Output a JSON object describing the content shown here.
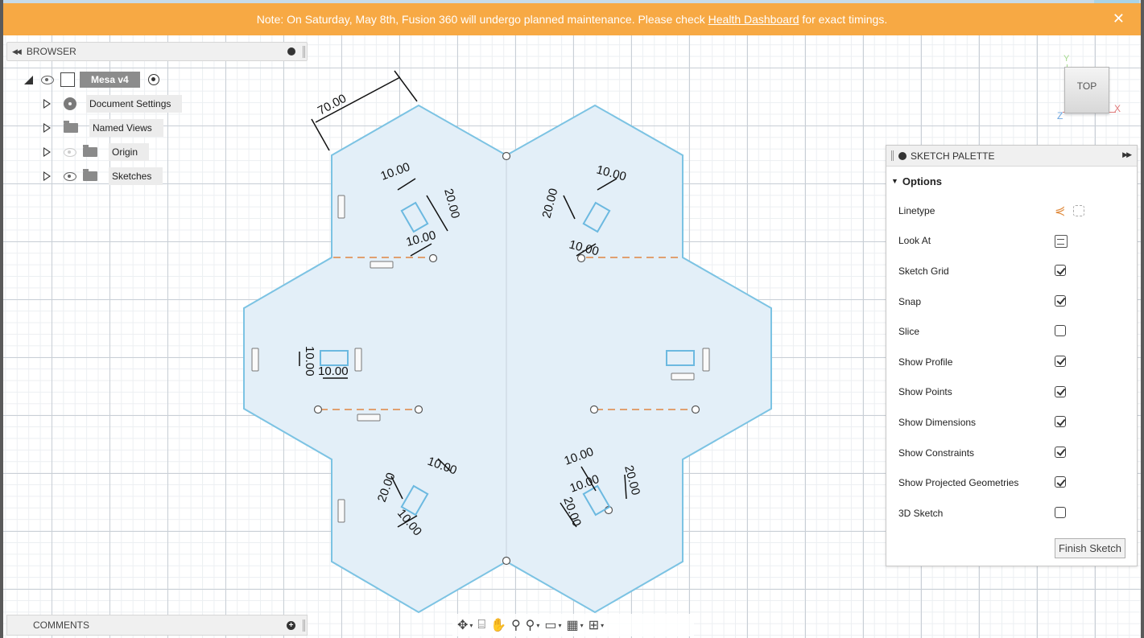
{
  "banner": {
    "message_before": "Note: On Saturday, May 8th, Fusion 360 will undergo planned maintenance. Please check ",
    "link_text": "Health Dashboard",
    "message_after": " for exact timings.",
    "close_glyph": "✕",
    "color": "#f7a944"
  },
  "browser": {
    "title": "BROWSER",
    "root_label": "Mesa v4",
    "items": [
      {
        "label": "Document Settings",
        "icon": "gear-icon"
      },
      {
        "label": "Named Views",
        "icon": "folder-icon"
      },
      {
        "label": "Origin",
        "icon": "folder-icon",
        "visibility": "hidden"
      },
      {
        "label": "Sketches",
        "icon": "folder-icon",
        "visibility": "visible"
      }
    ]
  },
  "comments": {
    "title": "COMMENTS"
  },
  "viewcube": {
    "face": "TOP",
    "axis_x": "X",
    "axis_y": "Y",
    "axis_z": "Z"
  },
  "palette": {
    "title": "SKETCH PALETTE",
    "section": "Options",
    "options": [
      {
        "label": "Linetype",
        "control": "linetype-icons"
      },
      {
        "label": "Look At",
        "control": "look-at-icon"
      },
      {
        "label": "Sketch Grid",
        "checked": true
      },
      {
        "label": "Snap",
        "checked": true
      },
      {
        "label": "Slice",
        "checked": false
      },
      {
        "label": "Show Profile",
        "checked": true
      },
      {
        "label": "Show Points",
        "checked": true
      },
      {
        "label": "Show Dimensions",
        "checked": true
      },
      {
        "label": "Show Constraints",
        "checked": true
      },
      {
        "label": "Show Projected Geometries",
        "checked": true
      },
      {
        "label": "3D Sketch",
        "checked": false
      }
    ],
    "finish_button": "Finish Sketch"
  },
  "sketch": {
    "dimensions": {
      "top_edge": "70.00",
      "ten": "10.00",
      "twenty": "20.00"
    },
    "colors": {
      "profile_fill": "#e3eff8",
      "profile_stroke": "#7cc3e3",
      "construction": "#e0a070"
    }
  },
  "nav_toolbar": {
    "icons": [
      "orbit-icon",
      "look-at-icon",
      "pan-icon",
      "zoom-icon",
      "fit-icon",
      "display-settings-icon",
      "grid-settings-icon",
      "viewports-icon"
    ]
  }
}
